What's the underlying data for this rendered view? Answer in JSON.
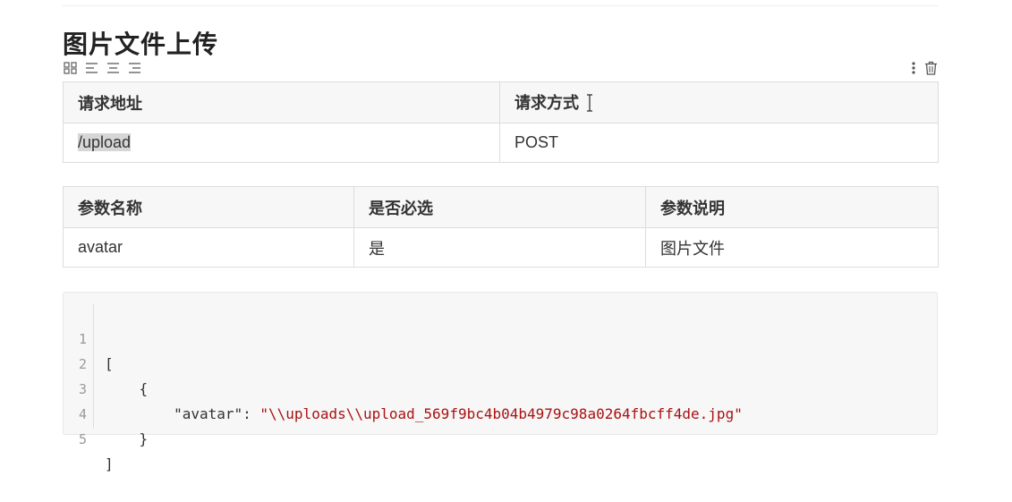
{
  "heading": "图片文件上传",
  "toolbar": {
    "left_icons": [
      "grid-icon",
      "align-left-icon",
      "align-center-icon",
      "align-right-icon"
    ],
    "right_icons": [
      "more-vertical-icon",
      "trash-icon"
    ]
  },
  "table1": {
    "headers": [
      "请求地址",
      "请求方式"
    ],
    "rows": [
      [
        "/upload",
        "POST"
      ]
    ]
  },
  "table2": {
    "headers": [
      "参数名称",
      "是否必选",
      "参数说明"
    ],
    "rows": [
      [
        "avatar",
        "是",
        "图片文件"
      ]
    ]
  },
  "code": {
    "line_numbers": [
      "1",
      "2",
      "3",
      "4",
      "5"
    ],
    "line1": "[",
    "line2": "    {",
    "line3_indent": "        ",
    "line3_key": "\"avatar\"",
    "line3_colon": ": ",
    "line3_value": "\"\\\\uploads\\\\upload_569f9bc4b04b4979c98a0264fbcff4de.jpg\"",
    "line4": "    }",
    "line5": "]"
  },
  "colors": {
    "string": "#aa1111",
    "header_bg": "#f7f7f7",
    "border": "#dddddd",
    "code_bg": "#f7f7f7"
  }
}
